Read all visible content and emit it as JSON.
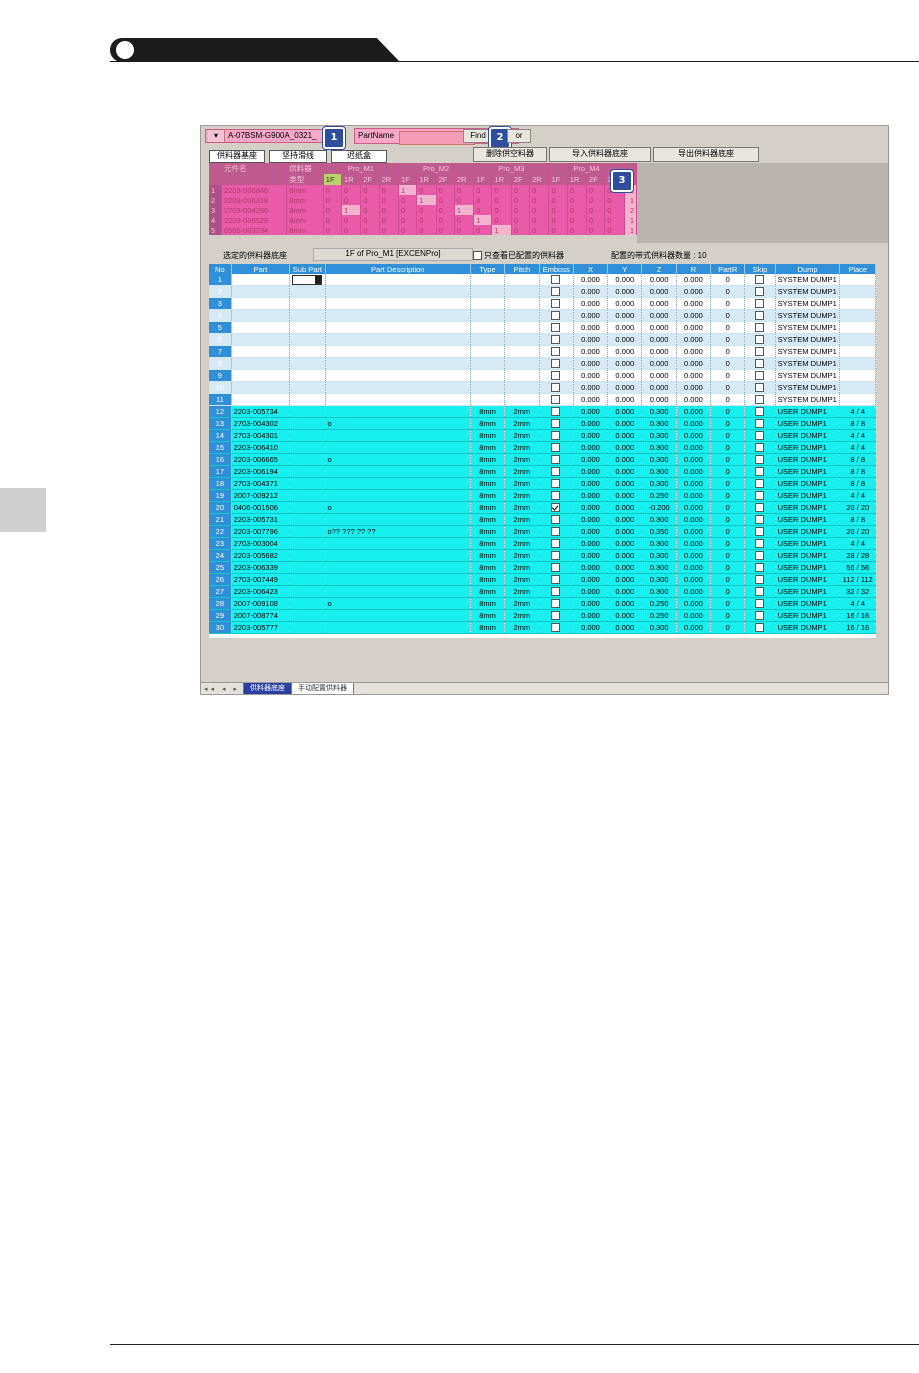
{
  "toolbar": {
    "board_selector_value": "A-07BSM-G900A_0321_",
    "partname_label": "PartName",
    "partname_value": "",
    "find_label": "Find",
    "or_label": "or",
    "badge_1": "1",
    "badge_2": "2",
    "badge_3": "3"
  },
  "tabs": {
    "tab1": "供料器基座",
    "tab2": "坚持滑线",
    "tab3": "迟纸盒",
    "btn_delete": "删除供空料器",
    "btn_import": "导入供料器底座",
    "btn_export": "导出供料器底座"
  },
  "feeder_grid": {
    "header_top": [
      "元件名",
      "供料器",
      "Pro_M1",
      "Pro_M2",
      "Pro_M3",
      "Pro_M4"
    ],
    "header_sub": [
      "类型",
      "1F",
      "1R",
      "2F",
      "2R",
      "1F",
      "1R",
      "2F",
      "2R",
      "1F",
      "1R",
      "2F",
      "2R",
      "1F",
      "1R",
      "2F",
      "2R"
    ],
    "rows": [
      {
        "n": "1",
        "part": "2203-006846",
        "type": "8mm",
        "vals": [
          "0",
          "0",
          "0",
          "0",
          "1",
          "0",
          "0",
          "0",
          "0",
          "0",
          "0",
          "0",
          "0",
          "0",
          "0",
          "0"
        ],
        "tail": "1"
      },
      {
        "n": "2",
        "part": "2203-006318",
        "type": "8mm",
        "vals": [
          "0",
          "0",
          "0",
          "0",
          "0",
          "1",
          "0",
          "0",
          "0",
          "0",
          "0",
          "0",
          "0",
          "0",
          "0",
          "0"
        ],
        "tail": "1"
      },
      {
        "n": "3",
        "part": "2703-004286",
        "type": "8mm",
        "vals": [
          "0",
          "1",
          "0",
          "0",
          "0",
          "0",
          "0",
          "1",
          "0",
          "0",
          "0",
          "0",
          "0",
          "0",
          "0",
          "0"
        ],
        "tail": "2"
      },
      {
        "n": "4",
        "part": "2203-006529",
        "type": "8mm",
        "vals": [
          "0",
          "0",
          "0",
          "0",
          "0",
          "0",
          "0",
          "0",
          "1",
          "0",
          "0",
          "0",
          "0",
          "0",
          "0",
          "0"
        ],
        "tail": "1"
      },
      {
        "n": "5",
        "part": "0505-003234",
        "type": "8mm",
        "vals": [
          "0",
          "0",
          "0",
          "0",
          "0",
          "0",
          "0",
          "0",
          "0",
          "1",
          "0",
          "0",
          "0",
          "0",
          "0",
          "0"
        ],
        "tail": "1"
      }
    ]
  },
  "selection": {
    "label": "选定的供料器底座",
    "value": "1F of Pro_M1 [EXCENPro]",
    "only_assigned_label": "只查看已配置的供料器",
    "count_label": "配置的带式供料器数量 : 10"
  },
  "main_table": {
    "headers": [
      "No",
      "Part",
      "Sub Part",
      "Part Description",
      "Type",
      "Pitch",
      "Emboss",
      "X",
      "Y",
      "Z",
      "R",
      "PartR",
      "Skip",
      "Dump",
      "Place"
    ],
    "rows": [
      {
        "no": "1",
        "part": "",
        "desc": "",
        "type": "",
        "pitch": "",
        "emboss": false,
        "x": "0.000",
        "y": "0.000",
        "z": "0.000",
        "r": "0.000",
        "partr": "0",
        "dump": "SYSTEM DUMP1",
        "place": "",
        "kind": "sys"
      },
      {
        "no": "2",
        "part": "",
        "desc": "",
        "type": "",
        "pitch": "",
        "emboss": false,
        "x": "0.000",
        "y": "0.000",
        "z": "0.000",
        "r": "0.000",
        "partr": "0",
        "dump": "SYSTEM DUMP1",
        "place": "",
        "kind": "sys"
      },
      {
        "no": "3",
        "part": "",
        "desc": "",
        "type": "",
        "pitch": "",
        "emboss": false,
        "x": "0.000",
        "y": "0.000",
        "z": "0.000",
        "r": "0.000",
        "partr": "0",
        "dump": "SYSTEM DUMP1",
        "place": "",
        "kind": "sys"
      },
      {
        "no": "4",
        "part": "",
        "desc": "",
        "type": "",
        "pitch": "",
        "emboss": false,
        "x": "0.000",
        "y": "0.000",
        "z": "0.000",
        "r": "0.000",
        "partr": "0",
        "dump": "SYSTEM DUMP1",
        "place": "",
        "kind": "sys"
      },
      {
        "no": "5",
        "part": "",
        "desc": "",
        "type": "",
        "pitch": "",
        "emboss": false,
        "x": "0.000",
        "y": "0.000",
        "z": "0.000",
        "r": "0.000",
        "partr": "0",
        "dump": "SYSTEM DUMP1",
        "place": "",
        "kind": "sys"
      },
      {
        "no": "6",
        "part": "",
        "desc": "",
        "type": "",
        "pitch": "",
        "emboss": false,
        "x": "0.000",
        "y": "0.000",
        "z": "0.000",
        "r": "0.000",
        "partr": "0",
        "dump": "SYSTEM DUMP1",
        "place": "",
        "kind": "sys"
      },
      {
        "no": "7",
        "part": "",
        "desc": "",
        "type": "",
        "pitch": "",
        "emboss": false,
        "x": "0.000",
        "y": "0.000",
        "z": "0.000",
        "r": "0.000",
        "partr": "0",
        "dump": "SYSTEM DUMP1",
        "place": "",
        "kind": "sys"
      },
      {
        "no": "8",
        "part": "",
        "desc": "",
        "type": "",
        "pitch": "",
        "emboss": false,
        "x": "0.000",
        "y": "0.000",
        "z": "0.000",
        "r": "0.000",
        "partr": "0",
        "dump": "SYSTEM DUMP1",
        "place": "",
        "kind": "sys"
      },
      {
        "no": "9",
        "part": "",
        "desc": "",
        "type": "",
        "pitch": "",
        "emboss": false,
        "x": "0.000",
        "y": "0.000",
        "z": "0.000",
        "r": "0.000",
        "partr": "0",
        "dump": "SYSTEM DUMP1",
        "place": "",
        "kind": "sys"
      },
      {
        "no": "10",
        "part": "",
        "desc": "",
        "type": "",
        "pitch": "",
        "emboss": false,
        "x": "0.000",
        "y": "0.000",
        "z": "0.000",
        "r": "0.000",
        "partr": "0",
        "dump": "SYSTEM DUMP1",
        "place": "",
        "kind": "sys"
      },
      {
        "no": "11",
        "part": "",
        "desc": "",
        "type": "",
        "pitch": "",
        "emboss": false,
        "x": "0.000",
        "y": "0.000",
        "z": "0.000",
        "r": "0.000",
        "partr": "0",
        "dump": "SYSTEM DUMP1",
        "place": "",
        "kind": "sys"
      },
      {
        "no": "12",
        "part": "2203-005734",
        "desc": "",
        "type": "8mm",
        "pitch": "2mm",
        "emboss": false,
        "x": "0.000",
        "y": "0.000",
        "z": "0.300",
        "r": "0.000",
        "partr": "0",
        "dump": "USER DUMP1",
        "place": "4 / 4",
        "kind": "usr"
      },
      {
        "no": "13",
        "part": "2703-004302",
        "desc": "o",
        "type": "8mm",
        "pitch": "2mm",
        "emboss": false,
        "x": "0.000",
        "y": "0.000",
        "z": "0.300",
        "r": "0.000",
        "partr": "0",
        "dump": "USER DUMP1",
        "place": "8 / 8",
        "kind": "usr"
      },
      {
        "no": "14",
        "part": "2703-004301",
        "desc": "",
        "type": "8mm",
        "pitch": "2mm",
        "emboss": false,
        "x": "0.000",
        "y": "0.000",
        "z": "0.300",
        "r": "0.000",
        "partr": "0",
        "dump": "USER DUMP1",
        "place": "4 / 4",
        "kind": "usr"
      },
      {
        "no": "15",
        "part": "2203-006410",
        "desc": "",
        "type": "8mm",
        "pitch": "2mm",
        "emboss": false,
        "x": "0.000",
        "y": "0.000",
        "z": "0.300",
        "r": "0.000",
        "partr": "0",
        "dump": "USER DUMP1",
        "place": "4 / 4",
        "kind": "usr"
      },
      {
        "no": "16",
        "part": "2203-006665",
        "desc": "o",
        "type": "8mm",
        "pitch": "2mm",
        "emboss": false,
        "x": "0.000",
        "y": "0.000",
        "z": "0.300",
        "r": "0.000",
        "partr": "0",
        "dump": "USER DUMP1",
        "place": "8 / 8",
        "kind": "usr"
      },
      {
        "no": "17",
        "part": "2203-006194",
        "desc": "",
        "type": "8mm",
        "pitch": "2mm",
        "emboss": false,
        "x": "0.000",
        "y": "0.000",
        "z": "0.300",
        "r": "0.000",
        "partr": "0",
        "dump": "USER DUMP1",
        "place": "8 / 8",
        "kind": "usr"
      },
      {
        "no": "18",
        "part": "2703-004371",
        "desc": "",
        "type": "8mm",
        "pitch": "2mm",
        "emboss": false,
        "x": "0.000",
        "y": "0.000",
        "z": "0.300",
        "r": "0.000",
        "partr": "0",
        "dump": "USER DUMP1",
        "place": "8 / 8",
        "kind": "usr"
      },
      {
        "no": "19",
        "part": "2007-009212",
        "desc": "",
        "type": "8mm",
        "pitch": "2mm",
        "emboss": false,
        "x": "0.000",
        "y": "0.000",
        "z": "0.250",
        "r": "0.000",
        "partr": "0",
        "dump": "USER DUMP1",
        "place": "4 / 4",
        "kind": "usr"
      },
      {
        "no": "20",
        "part": "0406-001506",
        "desc": "o",
        "type": "8mm",
        "pitch": "2mm",
        "emboss": true,
        "x": "0.000",
        "y": "0.000",
        "z": "-0.200",
        "r": "0.000",
        "partr": "0",
        "dump": "USER DUMP1",
        "place": "20 / 20",
        "kind": "usr"
      },
      {
        "no": "21",
        "part": "2203-005731",
        "desc": "",
        "type": "8mm",
        "pitch": "2mm",
        "emboss": false,
        "x": "0.000",
        "y": "0.000",
        "z": "0.300",
        "r": "0.000",
        "partr": "0",
        "dump": "USER DUMP1",
        "place": "8 / 8",
        "kind": "usr"
      },
      {
        "no": "22",
        "part": "2203-007796",
        "desc": "o?? ??? ?? ??",
        "type": "8mm",
        "pitch": "2mm",
        "emboss": false,
        "x": "0.000",
        "y": "0.000",
        "z": "0.350",
        "r": "0.000",
        "partr": "0",
        "dump": "USER DUMP1",
        "place": "20 / 20",
        "kind": "usr"
      },
      {
        "no": "23",
        "part": "2703-003004",
        "desc": "",
        "type": "8mm",
        "pitch": "2mm",
        "emboss": false,
        "x": "0.000",
        "y": "0.000",
        "z": "0.300",
        "r": "0.000",
        "partr": "0",
        "dump": "USER DUMP1",
        "place": "4 / 4",
        "kind": "usr"
      },
      {
        "no": "24",
        "part": "2203-005682",
        "desc": "",
        "type": "8mm",
        "pitch": "2mm",
        "emboss": false,
        "x": "0.000",
        "y": "0.000",
        "z": "0.300",
        "r": "0.000",
        "partr": "0",
        "dump": "USER DUMP1",
        "place": "28 / 28",
        "kind": "usr"
      },
      {
        "no": "25",
        "part": "2203-006339",
        "desc": "",
        "type": "8mm",
        "pitch": "2mm",
        "emboss": false,
        "x": "0.000",
        "y": "0.000",
        "z": "0.300",
        "r": "0.000",
        "partr": "0",
        "dump": "USER DUMP1",
        "place": "56 / 56",
        "kind": "usr"
      },
      {
        "no": "26",
        "part": "2703-007449",
        "desc": "",
        "type": "8mm",
        "pitch": "2mm",
        "emboss": false,
        "x": "0.000",
        "y": "0.000",
        "z": "0.300",
        "r": "0.000",
        "partr": "0",
        "dump": "USER DUMP1",
        "place": "112 / 112",
        "kind": "usr"
      },
      {
        "no": "27",
        "part": "2203-006423",
        "desc": "",
        "type": "8mm",
        "pitch": "2mm",
        "emboss": false,
        "x": "0.000",
        "y": "0.000",
        "z": "0.300",
        "r": "0.000",
        "partr": "0",
        "dump": "USER DUMP1",
        "place": "32 / 32",
        "kind": "usr"
      },
      {
        "no": "28",
        "part": "2007-009108",
        "desc": "o",
        "type": "8mm",
        "pitch": "2mm",
        "emboss": false,
        "x": "0.000",
        "y": "0.000",
        "z": "0.250",
        "r": "0.000",
        "partr": "0",
        "dump": "USER DUMP1",
        "place": "4 / 4",
        "kind": "usr"
      },
      {
        "no": "29",
        "part": "2007-008774",
        "desc": "",
        "type": "8mm",
        "pitch": "2mm",
        "emboss": false,
        "x": "0.000",
        "y": "0.000",
        "z": "0.250",
        "r": "0.000",
        "partr": "0",
        "dump": "USER DUMP1",
        "place": "16 / 16",
        "kind": "usr"
      },
      {
        "no": "30",
        "part": "2203-005777",
        "desc": "",
        "type": "8mm",
        "pitch": "2mm",
        "emboss": false,
        "x": "0.000",
        "y": "0.000",
        "z": "0.300",
        "r": "0.000",
        "partr": "0",
        "dump": "USER DUMP1",
        "place": "16 / 16",
        "kind": "usr"
      }
    ]
  },
  "bottom_tabs": {
    "nav": "◂◂ ◂ ▸ ▸▸",
    "tab_active": "供料器底座",
    "tab_other": "手动配置供料器"
  }
}
